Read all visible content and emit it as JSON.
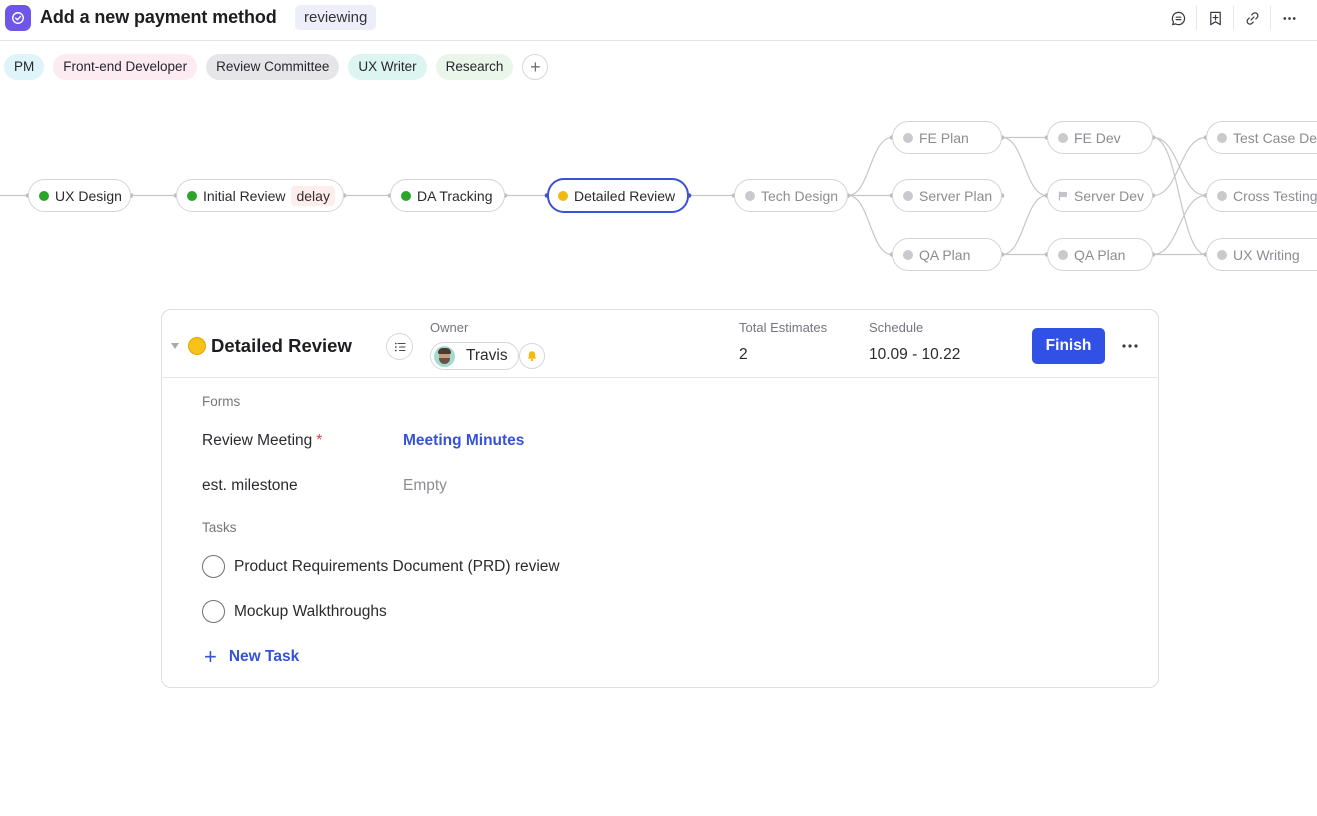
{
  "header": {
    "app_icon": "check-circle-icon",
    "title": "Add a new payment method",
    "status": "reviewing",
    "actions": [
      {
        "name": "comment",
        "icon": "comment-icon"
      },
      {
        "name": "bookmark",
        "icon": "bookmark-add-icon"
      },
      {
        "name": "link",
        "icon": "link-icon"
      },
      {
        "name": "more",
        "icon": "more-horizontal-icon"
      }
    ]
  },
  "roles": [
    {
      "label": "PM",
      "color": "#dff3fb"
    },
    {
      "label": "Front-end Developer",
      "color": "#fcebf1"
    },
    {
      "label": "Review Committee",
      "color": "#e6e6e8"
    },
    {
      "label": "UX Writer",
      "color": "#dcf5f1"
    },
    {
      "label": "Research",
      "color": "#eaf6ea"
    }
  ],
  "roles_add_label": "+",
  "flow": {
    "status_colors": {
      "done": "#2aa52a",
      "in_progress": "#f2b90f",
      "pending": "#c9c9ce",
      "active_border": "#3a52d6"
    },
    "nodes": [
      {
        "id": "ux-design",
        "label": "UX Design",
        "status": "done"
      },
      {
        "id": "initial-review",
        "label": "Initial Review",
        "status": "done",
        "badge": "delay"
      },
      {
        "id": "da-tracking",
        "label": "DA Tracking",
        "status": "done"
      },
      {
        "id": "detailed-review",
        "label": "Detailed Review",
        "status": "in_progress",
        "selected": true
      },
      {
        "id": "tech-design",
        "label": "Tech Design",
        "status": "pending"
      },
      {
        "id": "fe-plan",
        "label": "FE Plan",
        "status": "pending"
      },
      {
        "id": "server-plan",
        "label": "Server Plan",
        "status": "pending"
      },
      {
        "id": "qa-plan-1",
        "label": "QA Plan",
        "status": "pending"
      },
      {
        "id": "fe-dev",
        "label": "FE Dev",
        "status": "pending"
      },
      {
        "id": "server-dev",
        "label": "Server Dev",
        "status": "pending",
        "icon": "flag-icon"
      },
      {
        "id": "qa-plan-2",
        "label": "QA Plan",
        "status": "pending"
      },
      {
        "id": "test-case-design",
        "label": "Test Case De",
        "status": "pending"
      },
      {
        "id": "cross-testing",
        "label": "Cross Testing",
        "status": "pending"
      },
      {
        "id": "ux-writing",
        "label": "UX Writing",
        "status": "pending"
      }
    ],
    "edges": [
      [
        "start",
        "ux-design"
      ],
      [
        "ux-design",
        "initial-review"
      ],
      [
        "initial-review",
        "da-tracking"
      ],
      [
        "da-tracking",
        "detailed-review"
      ],
      [
        "detailed-review",
        "tech-design"
      ],
      [
        "tech-design",
        "fe-plan"
      ],
      [
        "tech-design",
        "server-plan"
      ],
      [
        "tech-design",
        "qa-plan-1"
      ],
      [
        "fe-plan",
        "fe-dev"
      ],
      [
        "fe-plan",
        "server-dev"
      ],
      [
        "qa-plan-1",
        "server-dev"
      ],
      [
        "qa-plan-1",
        "qa-plan-2"
      ],
      [
        "fe-dev",
        "cross-testing"
      ],
      [
        "fe-dev",
        "ux-writing"
      ],
      [
        "server-dev",
        "test-case-design"
      ],
      [
        "qa-plan-2",
        "cross-testing"
      ],
      [
        "qa-plan-2",
        "ux-writing"
      ]
    ]
  },
  "card": {
    "stage_title": "Detailed Review",
    "stage_status_color": "#f7c21a",
    "owner_label": "Owner",
    "owner_name": "Travis",
    "estimates_label": "Total Estimates",
    "estimates_value": "2",
    "schedule_label": "Schedule",
    "schedule_value": "10.09 - 10.22",
    "finish_label": "Finish",
    "forms_label": "Forms",
    "fields": [
      {
        "label": "Review Meeting",
        "required": true,
        "required_mark": "*",
        "value": "Meeting Minutes",
        "value_type": "link"
      },
      {
        "label": "est. milestone",
        "required": false,
        "value": "Empty",
        "value_type": "empty"
      }
    ],
    "tasks_label": "Tasks",
    "tasks": [
      {
        "label": "Product Requirements Document (PRD) review",
        "done": false
      },
      {
        "label": "Mockup Walkthroughs",
        "done": false
      }
    ],
    "new_task_label": "New Task"
  }
}
